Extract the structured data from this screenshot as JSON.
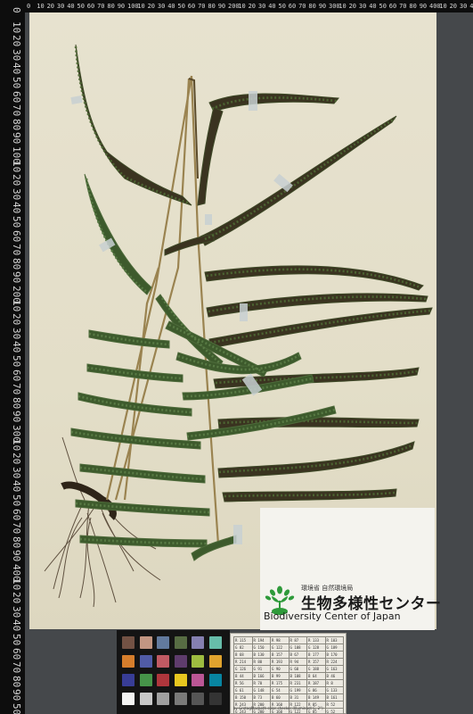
{
  "ruler": {
    "top_labels": [
      "0",
      "10",
      "20",
      "30",
      "40",
      "50",
      "60",
      "70",
      "80",
      "90",
      "100",
      "10",
      "20",
      "30",
      "40",
      "50",
      "60",
      "70",
      "80",
      "90",
      "200",
      "10",
      "20",
      "30",
      "40",
      "50",
      "60",
      "70",
      "80",
      "90",
      "300",
      "10",
      "20",
      "30",
      "40",
      "50",
      "60",
      "70",
      "80",
      "90",
      "400",
      "10",
      "20",
      "30",
      "40",
      "50"
    ],
    "left_labels": [
      "0",
      "10",
      "20",
      "30",
      "40",
      "50",
      "60",
      "70",
      "80",
      "90",
      "100",
      "10",
      "20",
      "30",
      "40",
      "50",
      "60",
      "70",
      "80",
      "90",
      "200",
      "10",
      "20",
      "30",
      "40",
      "50",
      "60",
      "70",
      "80",
      "90",
      "300",
      "10",
      "20",
      "30",
      "40",
      "50",
      "60",
      "70",
      "80",
      "90",
      "400",
      "10",
      "20",
      "30",
      "40",
      "50",
      "60",
      "70",
      "80",
      "90",
      "500"
    ]
  },
  "label": {
    "ministry": "環境省 自然環境局",
    "center_ja": "生物多様性センター",
    "center_en": "Biodiversity Center of Japan",
    "logo_icon": "plant-sprout-logo",
    "logo_color": "#2e9a3a"
  },
  "color_checker": {
    "patches": [
      "#735244",
      "#c29682",
      "#627a9d",
      "#576c43",
      "#8580b1",
      "#67bdaa",
      "#d67e2c",
      "#505ba6",
      "#c15a63",
      "#5e3c6c",
      "#9dbc40",
      "#e0a32e",
      "#383d96",
      "#469449",
      "#af363c",
      "#e7c71f",
      "#bb5695",
      "#0885a1",
      "#f3f3f2",
      "#c8c8c8",
      "#a0a0a0",
      "#7a7a79",
      "#555555",
      "#343434"
    ]
  },
  "values_card": {
    "rows": [
      [
        "R 115",
        "R 194",
        "R 98",
        "R 87",
        "R 133",
        "R 103"
      ],
      [
        "G 82",
        "G 150",
        "G 122",
        "G 108",
        "G 128",
        "G 189"
      ],
      [
        "B 68",
        "B 130",
        "B 157",
        "B 67",
        "B 177",
        "B 170"
      ],
      [
        "R 214",
        "R 80",
        "R 193",
        "R 94",
        "R 157",
        "R 224"
      ],
      [
        "G 126",
        "G 91",
        "G 90",
        "G 60",
        "G 188",
        "G 163"
      ],
      [
        "B 44",
        "B 166",
        "B 99",
        "B 108",
        "B 64",
        "B 46"
      ],
      [
        "R 56",
        "R 70",
        "R 175",
        "R 231",
        "R 187",
        "R 8"
      ],
      [
        "G 61",
        "G 148",
        "G 54",
        "G 199",
        "G 86",
        "G 133"
      ],
      [
        "B 150",
        "B 73",
        "B 60",
        "B 31",
        "B 149",
        "B 161"
      ],
      [
        "R 243",
        "R 200",
        "R 160",
        "R 122",
        "R 85",
        "R 52"
      ],
      [
        "G 243",
        "G 200",
        "G 160",
        "G 122",
        "G 85",
        "G 52"
      ],
      [
        "B 242",
        "B 200",
        "B 160",
        "B 121",
        "B 85",
        "B 52"
      ]
    ],
    "caption": "by GretagMacbeth color checker (Illuminant C, 2°)"
  },
  "colors": {
    "frond": "#3d5a2c",
    "frond_dark": "#3a3320",
    "stipe": "#9a8350",
    "roots": "#4a3a2a",
    "tape": "#c8d0d2"
  }
}
